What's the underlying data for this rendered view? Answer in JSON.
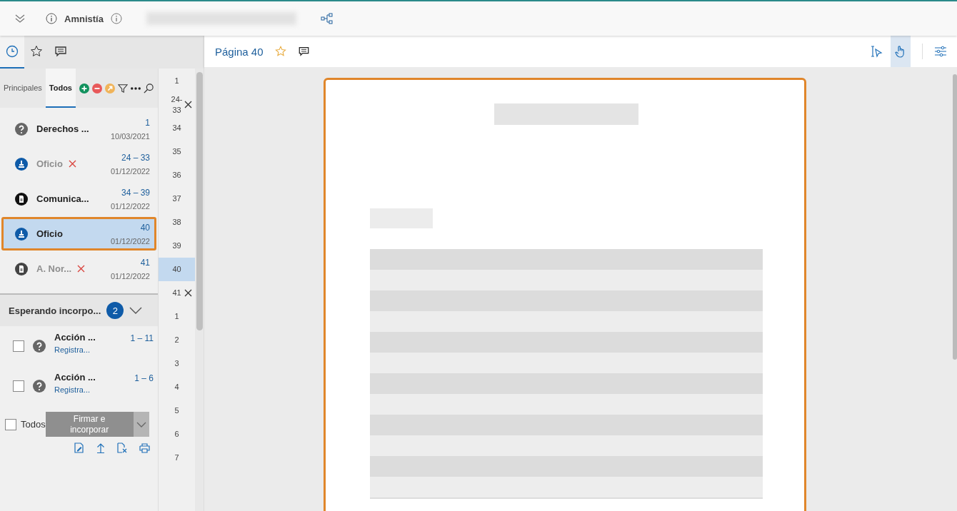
{
  "header": {
    "title": "Amnistía"
  },
  "panel_tabs": [
    {
      "selected": true
    },
    {
      "selected": false
    },
    {
      "selected": false
    }
  ],
  "filter_tabs": [
    {
      "label": "Principales",
      "selected": false
    },
    {
      "label": "Todos",
      "selected": true
    }
  ],
  "documents": [
    {
      "kind": "question",
      "name": "Derechos ...",
      "removed": false,
      "pages": "1",
      "date": "10/03/2021",
      "selected": false
    },
    {
      "kind": "stamp",
      "name": "Oficio",
      "removed": true,
      "pages": "24 – 33",
      "date": "01/12/2022",
      "selected": false
    },
    {
      "kind": "doc",
      "name": "Comunica...",
      "removed": false,
      "pages": "34 – 39",
      "date": "01/12/2022",
      "selected": false
    },
    {
      "kind": "stamp",
      "name": "Oficio",
      "removed": false,
      "pages": "40",
      "date": "01/12/2022",
      "selected": true
    },
    {
      "kind": "doc",
      "name": "A. Nor...",
      "removed": true,
      "pages": "41",
      "date": "01/12/2022",
      "selected": false
    }
  ],
  "pending": {
    "title": "Esperando incorpo...",
    "count": "2",
    "items": [
      {
        "checked": false,
        "name": "Acción ...",
        "sub": "Registra...",
        "pages": "1 – 11"
      },
      {
        "checked": false,
        "name": "Acción ...",
        "sub": "Registra...",
        "pages": "1 – 6"
      }
    ],
    "all_label": "Todos",
    "all_checked": false,
    "sign_button": "Firmar e incorporar"
  },
  "page_numbers": [
    {
      "label": "1",
      "removable": false,
      "selected": false
    },
    {
      "label": "24-33",
      "removable": true,
      "selected": false
    },
    {
      "label": "34",
      "removable": false,
      "selected": false
    },
    {
      "label": "35",
      "removable": false,
      "selected": false
    },
    {
      "label": "36",
      "removable": false,
      "selected": false
    },
    {
      "label": "37",
      "removable": false,
      "selected": false
    },
    {
      "label": "38",
      "removable": false,
      "selected": false
    },
    {
      "label": "39",
      "removable": false,
      "selected": false
    },
    {
      "label": "40",
      "removable": false,
      "selected": true
    },
    {
      "label": "41",
      "removable": true,
      "selected": false
    },
    {
      "label": "1",
      "removable": false,
      "selected": false
    },
    {
      "label": "2",
      "removable": false,
      "selected": false
    },
    {
      "label": "3",
      "removable": false,
      "selected": false
    },
    {
      "label": "4",
      "removable": false,
      "selected": false
    },
    {
      "label": "5",
      "removable": false,
      "selected": false
    },
    {
      "label": "6",
      "removable": false,
      "selected": false
    },
    {
      "label": "7",
      "removable": false,
      "selected": false
    }
  ],
  "viewer": {
    "page_title": "Página 40",
    "tools": [
      {
        "selected": false
      },
      {
        "selected": true
      }
    ]
  }
}
